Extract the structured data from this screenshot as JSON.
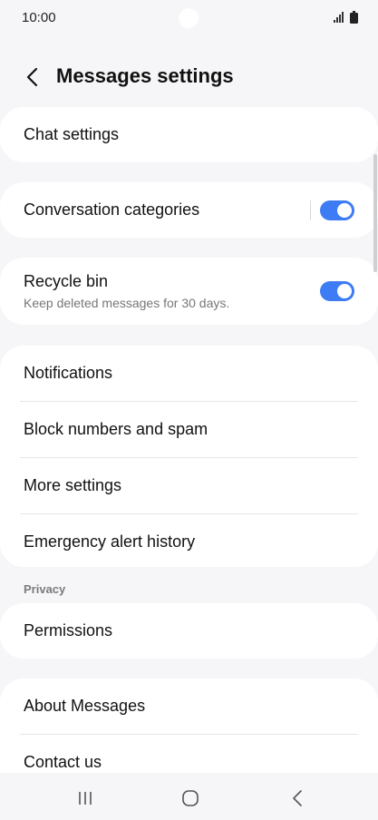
{
  "status": {
    "time": "10:00"
  },
  "header": {
    "title": "Messages settings"
  },
  "cards": {
    "chat": {
      "label": "Chat settings"
    },
    "conversation": {
      "label": "Conversation categories",
      "enabled": true
    },
    "recycle": {
      "label": "Recycle bin",
      "sublabel": "Keep deleted messages for 30 days.",
      "enabled": true
    },
    "main_list": [
      "Notifications",
      "Block numbers and spam",
      "More settings",
      "Emergency alert history"
    ],
    "privacy_section": "Privacy",
    "permissions": "Permissions",
    "about_list": [
      "About Messages",
      "Contact us"
    ]
  },
  "colors": {
    "accent": "#3e7cf5",
    "background": "#f6f6f8",
    "card": "#ffffff"
  }
}
